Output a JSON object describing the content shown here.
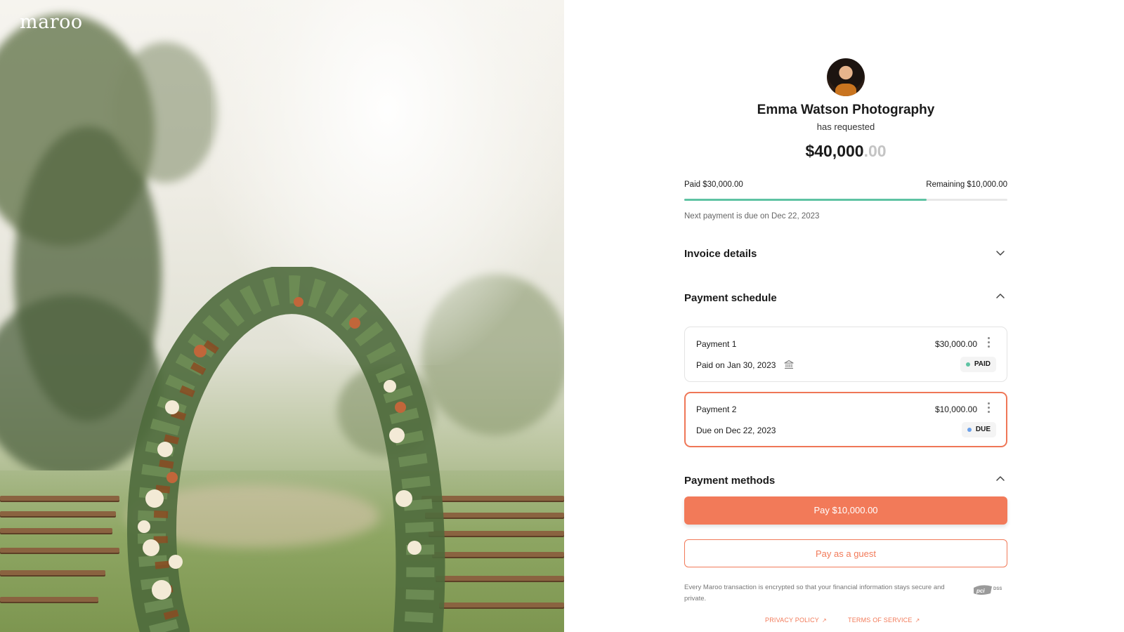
{
  "brand": {
    "logo_text": "maroo",
    "accent": "#f27a59",
    "progress_color": "#5fc3a3"
  },
  "request": {
    "business_name": "Emma Watson Photography",
    "subtitle": "has requested",
    "amount_main": "$40,000",
    "amount_cents": ".00",
    "paid_label": "Paid $30,000.00",
    "remaining_label": "Remaining $10,000.00",
    "progress_fraction": 0.75,
    "next_payment_text": "Next payment is due on Dec 22, 2023"
  },
  "sections": {
    "invoice_details": {
      "title": "Invoice details",
      "icon": "chevron-down-icon"
    },
    "payment_schedule": {
      "title": "Payment schedule",
      "icon": "chevron-up-icon"
    },
    "payment_methods": {
      "title": "Payment methods",
      "icon": "chevron-up-icon"
    }
  },
  "payments": [
    {
      "title": "Payment 1",
      "amount": "$30,000.00",
      "sub": "Paid on Jan 30, 2023",
      "status": "PAID",
      "status_color": "#5fc3a3",
      "icon": "bank-icon"
    },
    {
      "title": "Payment 2",
      "amount": "$10,000.00",
      "sub": "Due on Dec 22, 2023",
      "status": "DUE",
      "status_color": "#6a9fe8"
    }
  ],
  "actions": {
    "pay_label": "Pay $10,000.00",
    "guest_label": "Pay as a guest"
  },
  "footer": {
    "secure_text": "Every Maroo transaction is encrypted so that your financial information stays secure and private.",
    "pci_label": "PCI DSS",
    "privacy_label": "PRIVACY POLICY",
    "terms_label": "TERMS OF SERVICE"
  }
}
